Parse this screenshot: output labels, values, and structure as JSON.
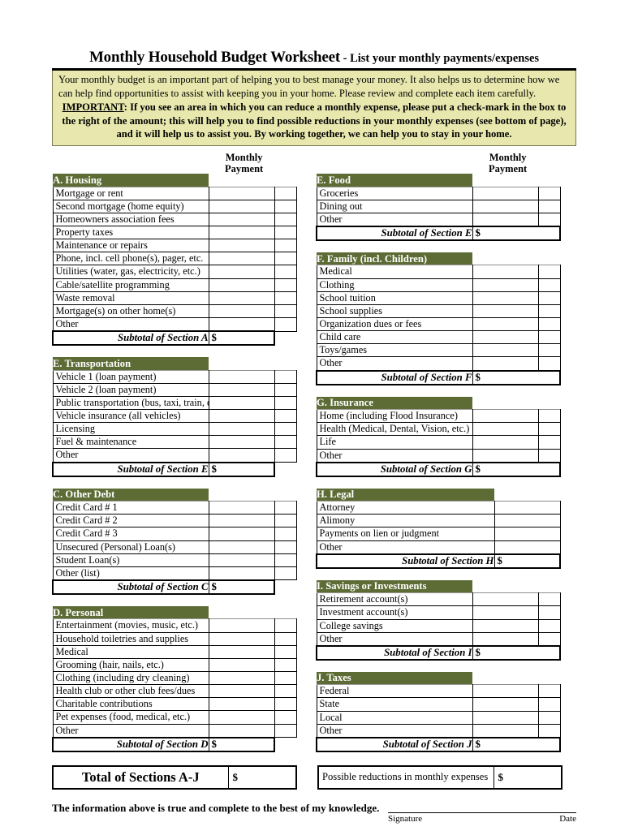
{
  "title": {
    "main": "Monthly Household Budget Worksheet",
    "separator": " - ",
    "sub": "List your monthly payments/expenses"
  },
  "intro": {
    "paragraph1": "Your monthly budget is an important part of helping you to best manage your money. It also helps us to determine how we can help find opportunities to assist with keeping you in your home. Please review and complete each item carefully.",
    "important_label": "IMPORTANT",
    "paragraph2": ": If you see an area in which you can reduce a monthly expense, please put a check-mark in the box to the right of the amount; this will help you to find possible reductions in your monthly expenses (see bottom of page), and it will help us to assist you. By working together, we can help you to stay in your home."
  },
  "column_header": {
    "line1": "Monthly",
    "line2": "Payment"
  },
  "currency_symbol": "$",
  "colors": {
    "section_header_green": "#5d6b35",
    "intro_yellow": "#e8e8ae",
    "border_black": "#000000"
  },
  "left_sections": [
    {
      "header": "A. Housing",
      "subtotal_label": "Subtotal of Section A",
      "has_checkbox": true,
      "rows": [
        "Mortgage or rent",
        "Second mortgage (home equity)",
        "Homeowners association fees",
        "Property taxes",
        "Maintenance or repairs",
        "Phone, incl. cell phone(s), pager, etc.",
        "Utilities (water, gas, electricity, etc.)",
        "Cable/satellite programming",
        "Waste removal",
        "Mortgage(s) on other home(s)",
        "Other"
      ]
    },
    {
      "header": "E. Transportation",
      "subtotal_label": "Subtotal of Section E",
      "has_checkbox": true,
      "rows": [
        "Vehicle 1 (loan payment)",
        "Vehicle 2 (loan payment)",
        "Public transportation (bus, taxi, train, etc.)",
        "Vehicle insurance (all vehicles)",
        "Licensing",
        "Fuel & maintenance",
        "Other"
      ]
    },
    {
      "header": "C. Other Debt",
      "subtotal_label": "Subtotal of Section C",
      "has_checkbox": true,
      "rows": [
        "Credit Card # 1",
        "Credit Card # 2",
        "Credit Card # 3",
        "Unsecured (Personal) Loan(s)",
        "Student Loan(s)",
        "Other (list)"
      ]
    },
    {
      "header": "D. Personal",
      "subtotal_label": "Subtotal of Section D",
      "has_checkbox": true,
      "rows": [
        "Entertainment (movies, music, etc.)",
        "Household toiletries and supplies",
        "Medical",
        "Grooming (hair, nails, etc.)",
        "Clothing (including dry cleaning)",
        "Health club or other club fees/dues",
        "Charitable contributions",
        "Pet expenses (food, medical, etc.)",
        "Other"
      ]
    }
  ],
  "right_sections": [
    {
      "header": "E. Food",
      "subtotal_label": "Subtotal of Section E",
      "has_checkbox": true,
      "rows": [
        "Groceries",
        "Dining out",
        "Other"
      ]
    },
    {
      "header": "F. Family (incl. Children)",
      "subtotal_label": "Subtotal of Section F",
      "has_checkbox": true,
      "rows": [
        "Medical",
        "Clothing",
        "School tuition",
        "School supplies",
        "Organization dues or fees",
        "Child care",
        "Toys/games",
        "Other"
      ]
    },
    {
      "header": "G. Insurance",
      "subtotal_label": "Subtotal of Section G",
      "has_checkbox": true,
      "rows": [
        "Home (including Flood Insurance)",
        "Health (Medical, Dental, Vision, etc.)",
        "Life",
        "Other"
      ]
    },
    {
      "header": "H. Legal",
      "subtotal_label": "Subtotal of Section H",
      "has_checkbox": false,
      "rows": [
        "Attorney",
        "Alimony",
        "Payments on lien or judgment",
        "Other"
      ]
    },
    {
      "header": "I. Savings or Investments",
      "subtotal_label": "Subtotal of Section I",
      "has_checkbox": true,
      "rows": [
        "Retirement account(s)",
        "Investment account(s)",
        "College savings",
        "Other"
      ]
    },
    {
      "header": "J. Taxes",
      "subtotal_label": "Subtotal of Section J",
      "has_checkbox": true,
      "rows": [
        "Federal",
        "State",
        "Local",
        "Other"
      ]
    }
  ],
  "totals": {
    "grand_total_label": "Total of Sections A-J",
    "grand_total_value": "$",
    "reductions_label": "Possible reductions in monthly expenses",
    "reductions_value": "$"
  },
  "signature": {
    "attestation": "The information above is true and complete to the best of my knowledge.",
    "signature_label": "Signature",
    "date_label": "Date"
  }
}
